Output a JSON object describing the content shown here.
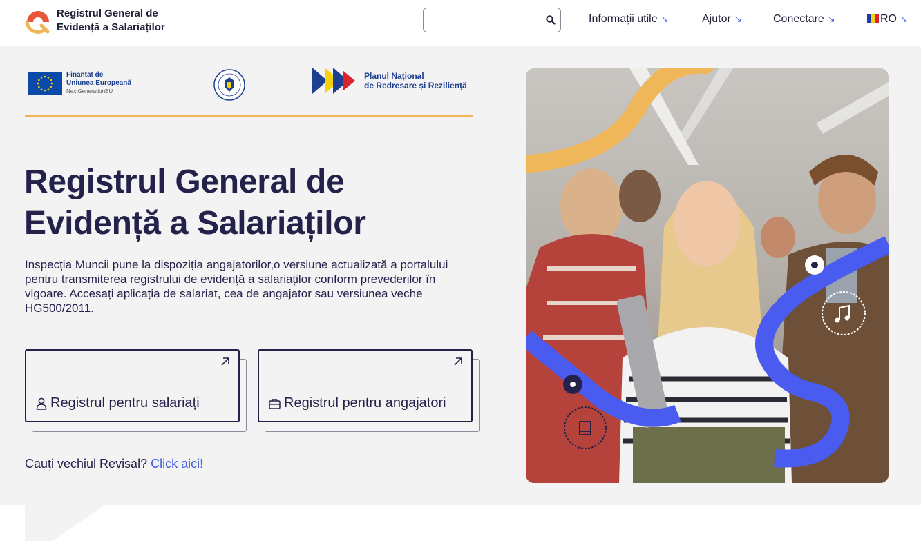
{
  "header": {
    "brand_title": "Registrul General de Evidență a Salariaților",
    "search": {
      "placeholder": ""
    },
    "nav": {
      "info": "Informații utile",
      "help": "Ajutor",
      "login": "Conectare",
      "lang": "RO"
    },
    "nav_arrow": "↘"
  },
  "logos": {
    "eu_line1": "Finanțat de",
    "eu_line2": "Uniunea Europeană",
    "eu_line3": "NextGenerationEU",
    "gov_seal_text": "GUVERNUL ROMÂNIEI",
    "pnrr_line1": "Planul Național",
    "pnrr_line2": "de Redresare și Reziliență"
  },
  "hero": {
    "title": "Registrul General de Evidență a Salariaților",
    "description": "Inspecția Muncii pune la dispoziția angajatorilor,o versiune actualizată a portalului pentru transmiterea registrului de evidență a salariaților conform prevederilor în vigoare. Accesați aplicația de salariat, cea de angajator sau versiunea veche HG500/2011.",
    "cards": [
      {
        "label": "Registrul pentru salariați",
        "icon": "user-icon"
      },
      {
        "label": "Registrul pentru angajatori",
        "icon": "briefcase-icon"
      }
    ],
    "revisal_prefix": "Cauți vechiul Revisal?",
    "revisal_link": "Click aici!"
  },
  "colors": {
    "primary_dark": "#24224a",
    "accent_blue": "#3f5be0",
    "accent_orange": "#f0b65a",
    "hero_bg": "#f3f3f3",
    "deco_blue": "#4a5bf0"
  }
}
